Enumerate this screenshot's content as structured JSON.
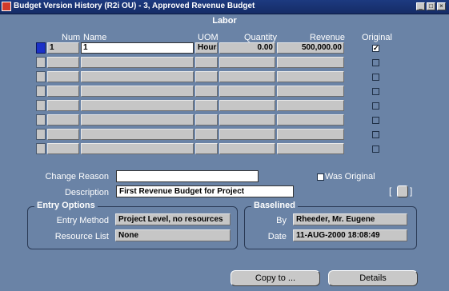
{
  "window": {
    "title": "Budget Version History (R2i OU) - 3, Approved Revenue Budget",
    "controls": [
      "minimize-icon",
      "maximize-icon",
      "close-icon"
    ]
  },
  "labor": {
    "section_title": "Labor",
    "columns": {
      "num": "Num",
      "name": "Name",
      "uom": "UOM",
      "quantity": "Quantity",
      "revenue": "Revenue",
      "original": "Original"
    },
    "rows": [
      {
        "num": "1",
        "name": "1",
        "uom": "Hours",
        "quantity": "0.00",
        "revenue": "500,000.00",
        "original": true
      },
      {
        "num": "",
        "name": "",
        "uom": "",
        "quantity": "",
        "revenue": "",
        "original": false
      },
      {
        "num": "",
        "name": "",
        "uom": "",
        "quantity": "",
        "revenue": "",
        "original": false
      },
      {
        "num": "",
        "name": "",
        "uom": "",
        "quantity": "",
        "revenue": "",
        "original": false
      },
      {
        "num": "",
        "name": "",
        "uom": "",
        "quantity": "",
        "revenue": "",
        "original": false
      },
      {
        "num": "",
        "name": "",
        "uom": "",
        "quantity": "",
        "revenue": "",
        "original": false
      },
      {
        "num": "",
        "name": "",
        "uom": "",
        "quantity": "",
        "revenue": "",
        "original": false
      },
      {
        "num": "",
        "name": "",
        "uom": "",
        "quantity": "",
        "revenue": "",
        "original": false
      }
    ]
  },
  "form": {
    "change_reason_label": "Change Reason",
    "change_reason_value": "",
    "was_original_label": "Was Original",
    "description_label": "Description",
    "description_value": "First Revenue Budget for Project"
  },
  "entry_options": {
    "title": "Entry Options",
    "entry_method_label": "Entry Method",
    "entry_method_value": "Project Level, no resources",
    "resource_list_label": "Resource List",
    "resource_list_value": "None"
  },
  "baselined": {
    "title": "Baselined",
    "by_label": "By",
    "by_value": "Rheeder, Mr. Eugene",
    "date_label": "Date",
    "date_value": "11-AUG-2000 18:08:49"
  },
  "buttons": {
    "copy_to": "Copy to ...",
    "details": "Details"
  },
  "colors": {
    "background": "#6a83a6",
    "titlebar": "#1d3a80",
    "selected_row": "#1b31c8"
  }
}
